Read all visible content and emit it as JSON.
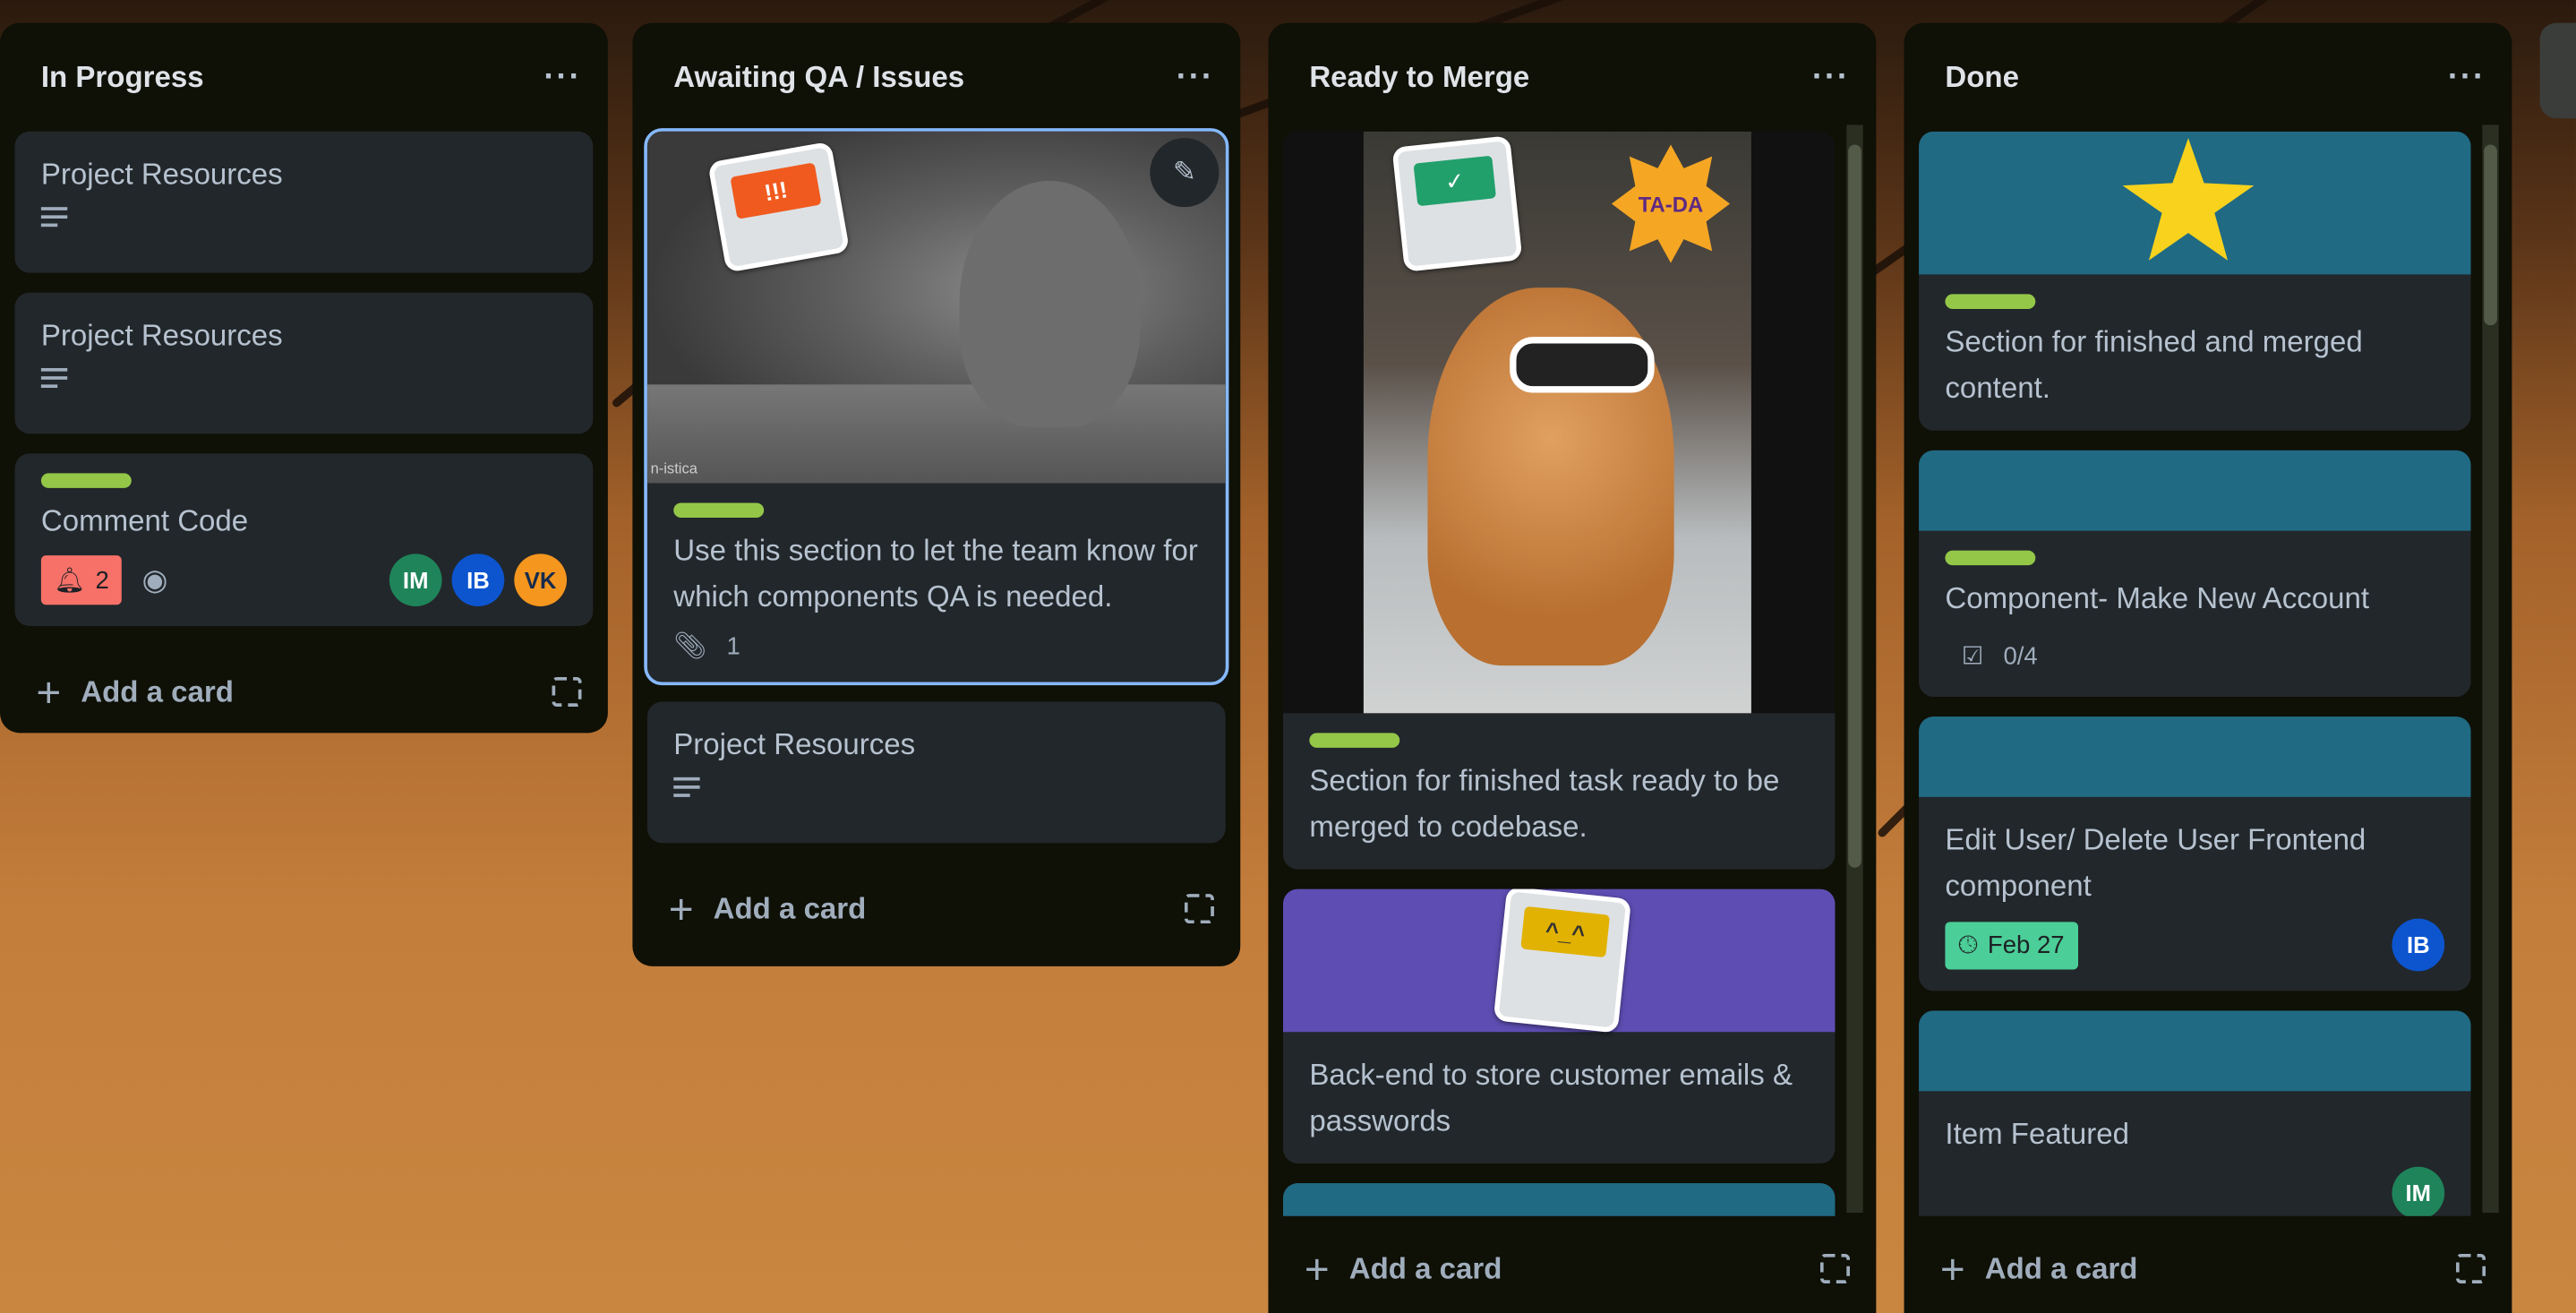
{
  "colors": {
    "label_green": "#94c748",
    "cover_teal": "#206a83",
    "cover_purple": "#5e4db2",
    "due_green": "#4bce97",
    "badge_red": "#f87168"
  },
  "lists": [
    {
      "title": "In Progress",
      "menu": "···",
      "add_card": "Add a card",
      "cards": [
        {
          "title": "Project Resources",
          "icon": "description-icon"
        },
        {
          "title": "Project Resources",
          "icon": "description-icon"
        },
        {
          "title": "Comment Code",
          "notification_count": "2",
          "icon": "watch-eye-icon",
          "members": [
            "IM",
            "IB",
            "VK"
          ]
        }
      ]
    },
    {
      "title": "Awaiting QA / Issues",
      "menu": "···",
      "add_card": "Add a card",
      "cards": [
        {
          "title": "Use this section to let the team know for which components QA is needed.",
          "attachments": "1",
          "sticker": "!!!",
          "image_caption": "n-istica"
        },
        {
          "title": "Project Resources",
          "icon": "description-icon"
        }
      ]
    },
    {
      "title": "Ready to Merge",
      "menu": "···",
      "add_card": "Add a card",
      "cards": [
        {
          "title": "Section for finished task ready to be merged to codebase.",
          "sticker": "TA-DA"
        },
        {
          "title": "Back-end to store customer emails & passwords"
        }
      ]
    },
    {
      "title": "Done",
      "menu": "···",
      "add_card": "Add a card",
      "cards": [
        {
          "title": "Section for finished and merged content."
        },
        {
          "title": "Component- Make New Account",
          "checklist": "0/4"
        },
        {
          "title": "Edit User/ Delete User Frontend component",
          "due": "Feb 27",
          "members": [
            "IB"
          ]
        },
        {
          "title": "Item Featured",
          "members": [
            "IM"
          ]
        }
      ]
    }
  ]
}
